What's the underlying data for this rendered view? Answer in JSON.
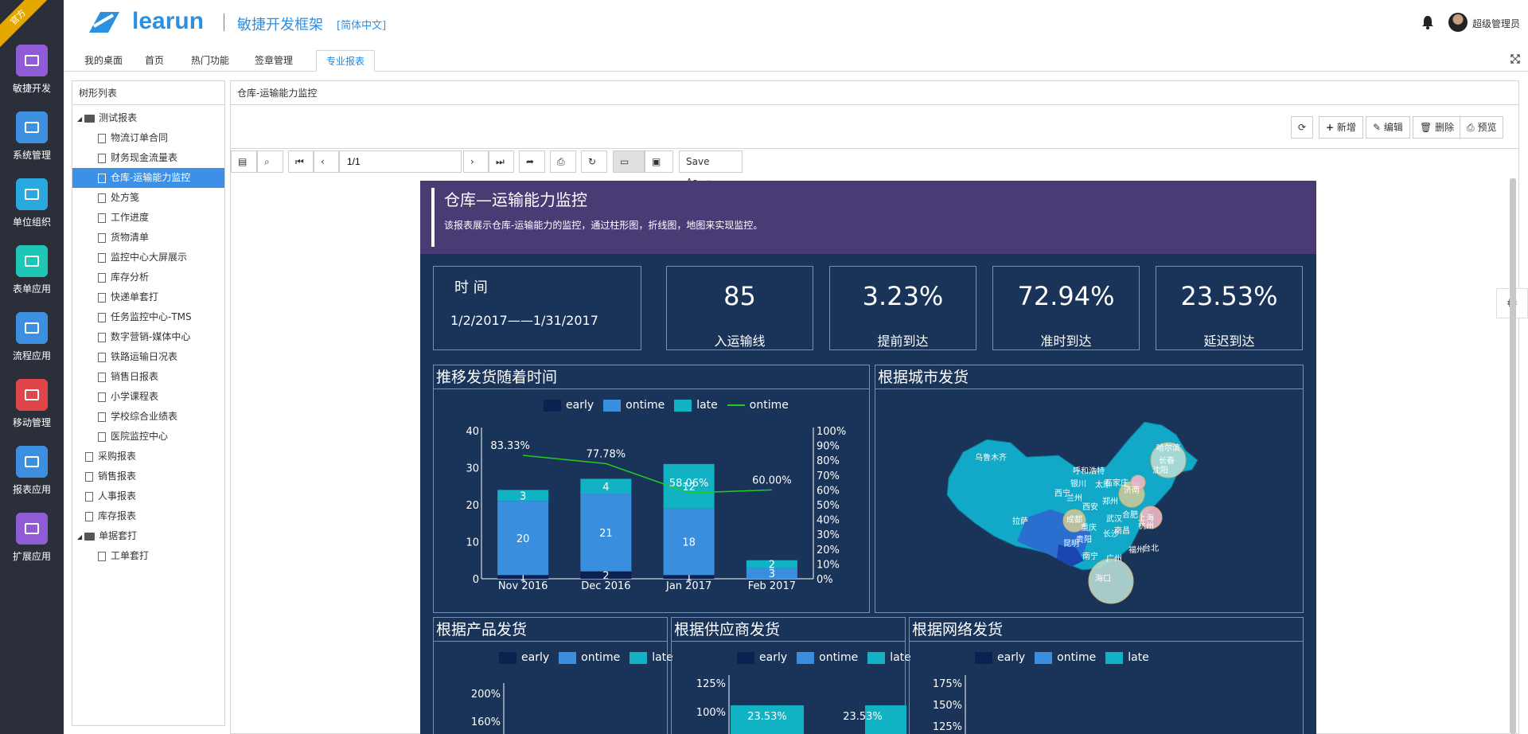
{
  "ribbon": "官方",
  "apps": [
    {
      "label": "敏捷开发",
      "icon": "paper-plane-icon",
      "color": "#8f5bd6"
    },
    {
      "label": "系统管理",
      "icon": "monitor-icon",
      "color": "#3d8fe0"
    },
    {
      "label": "单位组织",
      "icon": "coffee-icon",
      "color": "#29a8e0"
    },
    {
      "label": "表单应用",
      "icon": "table-icon",
      "color": "#1fc5b5"
    },
    {
      "label": "流程应用",
      "icon": "share-icon",
      "color": "#3d8fe0"
    },
    {
      "label": "移动管理",
      "icon": "android-icon",
      "color": "#e0454a"
    },
    {
      "label": "报表应用",
      "icon": "area-chart-icon",
      "color": "#3d8fe0"
    },
    {
      "label": "扩展应用",
      "icon": "globe-icon",
      "color": "#8f5bd6"
    }
  ],
  "header": {
    "logo": "learun",
    "product": "敏捷开发框架",
    "lang": "[简体中文]",
    "user": "超级管理员"
  },
  "tabs": [
    "我的桌面",
    "首页",
    "热门功能",
    "签章管理",
    "专业报表"
  ],
  "tree": {
    "title": "树形列表",
    "nodes": [
      {
        "label": "测试报表",
        "level": 0,
        "folder": true
      },
      {
        "label": "物流订单合同",
        "level": 1
      },
      {
        "label": "财务现金流量表",
        "level": 1
      },
      {
        "label": "仓库-运输能力监控",
        "level": 1,
        "selected": true
      },
      {
        "label": "处方笺",
        "level": 1
      },
      {
        "label": "工作进度",
        "level": 1
      },
      {
        "label": "货物清单",
        "level": 1
      },
      {
        "label": "监控中心大屏展示",
        "level": 1
      },
      {
        "label": "库存分析",
        "level": 1
      },
      {
        "label": "快递单套打",
        "level": 1
      },
      {
        "label": "任务监控中心-TMS",
        "level": 1
      },
      {
        "label": "数字营销-媒体中心",
        "level": 1
      },
      {
        "label": "铁路运输日况表",
        "level": 1
      },
      {
        "label": "销售日报表",
        "level": 1
      },
      {
        "label": "小学课程表",
        "level": 1
      },
      {
        "label": "学校综合业绩表",
        "level": 1
      },
      {
        "label": "医院监控中心",
        "level": 1
      },
      {
        "label": "采购报表",
        "level": 0
      },
      {
        "label": "销售报表",
        "level": 0
      },
      {
        "label": "人事报表",
        "level": 0
      },
      {
        "label": "库存报表",
        "level": 0
      },
      {
        "label": "单据套打",
        "level": 0,
        "folder": true
      },
      {
        "label": "工单套打",
        "level": 1
      }
    ]
  },
  "main_title": "仓库-运输能力监控",
  "actions": [
    {
      "label": "新增",
      "icon": "plus-icon"
    },
    {
      "label": "编辑",
      "icon": "edit-icon"
    },
    {
      "label": "删除",
      "icon": "trash-icon"
    },
    {
      "label": "预览",
      "icon": "print-icon"
    }
  ],
  "viewer": {
    "page": "1/1",
    "save_as": "Save As..."
  },
  "report": {
    "title": "仓库—运输能力监控",
    "desc": "该报表展示仓库-运输能力的监控，通过柱形图，折线图，地图来实现监控。",
    "time_label": "时  间",
    "time_range": "1/2/2017——1/31/2017",
    "kpis": [
      {
        "value": "85",
        "label": "入运输线"
      },
      {
        "value": "3.23%",
        "label": "提前到达"
      },
      {
        "value": "72.94%",
        "label": "准时到达"
      },
      {
        "value": "23.53%",
        "label": "延迟到达"
      }
    ],
    "panel_titles": {
      "trend": "推移发货随着时间",
      "city": "根据城市发货",
      "product": "根据产品发货",
      "supplier": "根据供应商发货",
      "network": "根据网络发货"
    },
    "legend": {
      "early": "early",
      "ontime": "ontime",
      "late": "late"
    },
    "colors": {
      "early": "#0b2150",
      "ontime": "#3a8ede",
      "late": "#10b2c4",
      "line": "#22cc22",
      "map_fill": "#12a8c8",
      "map_deep": "#2a6fd0"
    }
  },
  "chart_data": [
    {
      "type": "bar",
      "stacked": true,
      "categories": [
        "Nov 2016",
        "Dec 2016",
        "Jan 2017",
        "Feb 2017"
      ],
      "series": [
        {
          "name": "early",
          "values": [
            1,
            2,
            1,
            0
          ]
        },
        {
          "name": "ontime",
          "values": [
            20,
            21,
            18,
            3
          ]
        },
        {
          "name": "late",
          "values": [
            3,
            4,
            12,
            2
          ]
        }
      ],
      "line": {
        "name": "ontime",
        "values": [
          83.33,
          77.78,
          58.06,
          60.0
        ],
        "labels": [
          "83.33%",
          "77.78%",
          "58.06%",
          "60.00%"
        ],
        "axis": "right"
      },
      "ylim": [
        0,
        40
      ],
      "y_ticks": [
        "0",
        "10",
        "20",
        "30",
        "40"
      ],
      "y2lim": [
        0,
        100
      ],
      "y2_ticks": [
        "0%",
        "10%",
        "20%",
        "30%",
        "40%",
        "50%",
        "60%",
        "70%",
        "80%",
        "90%",
        "100%"
      ],
      "legend": "top"
    },
    {
      "type": "bar",
      "stacked": true,
      "series": [
        {
          "name": "early"
        },
        {
          "name": "ontime"
        },
        {
          "name": "late"
        }
      ],
      "y_ticks_visible": [
        "200%",
        "160%"
      ],
      "legend": "top"
    },
    {
      "type": "bar",
      "stacked": true,
      "categories_visible": 2,
      "series": [
        {
          "name": "early"
        },
        {
          "name": "ontime"
        },
        {
          "name": "late",
          "labels": [
            "23.53%",
            "23.53%"
          ]
        }
      ],
      "y_ticks_visible": [
        "125%",
        "100%"
      ],
      "legend": "top"
    },
    {
      "type": "bar",
      "stacked": true,
      "series": [
        {
          "name": "early"
        },
        {
          "name": "ontime"
        },
        {
          "name": "late"
        }
      ],
      "y_ticks_visible": [
        "175%",
        "150%",
        "125%"
      ],
      "legend": "top"
    }
  ],
  "map": {
    "labels": [
      "乌鲁木齐",
      "呼和浩特",
      "银川",
      "西宁",
      "兰州",
      "太原",
      "石家庄",
      "济南",
      "郑州",
      "西安",
      "成都",
      "重庆",
      "贵阳",
      "昆明",
      "拉萨",
      "长沙",
      "南昌",
      "武汉",
      "合肥",
      "上海",
      "杭州",
      "福州",
      "台北",
      "南宁",
      "广州",
      "海口",
      "哈尔滨",
      "长春",
      "沈阳"
    ]
  }
}
